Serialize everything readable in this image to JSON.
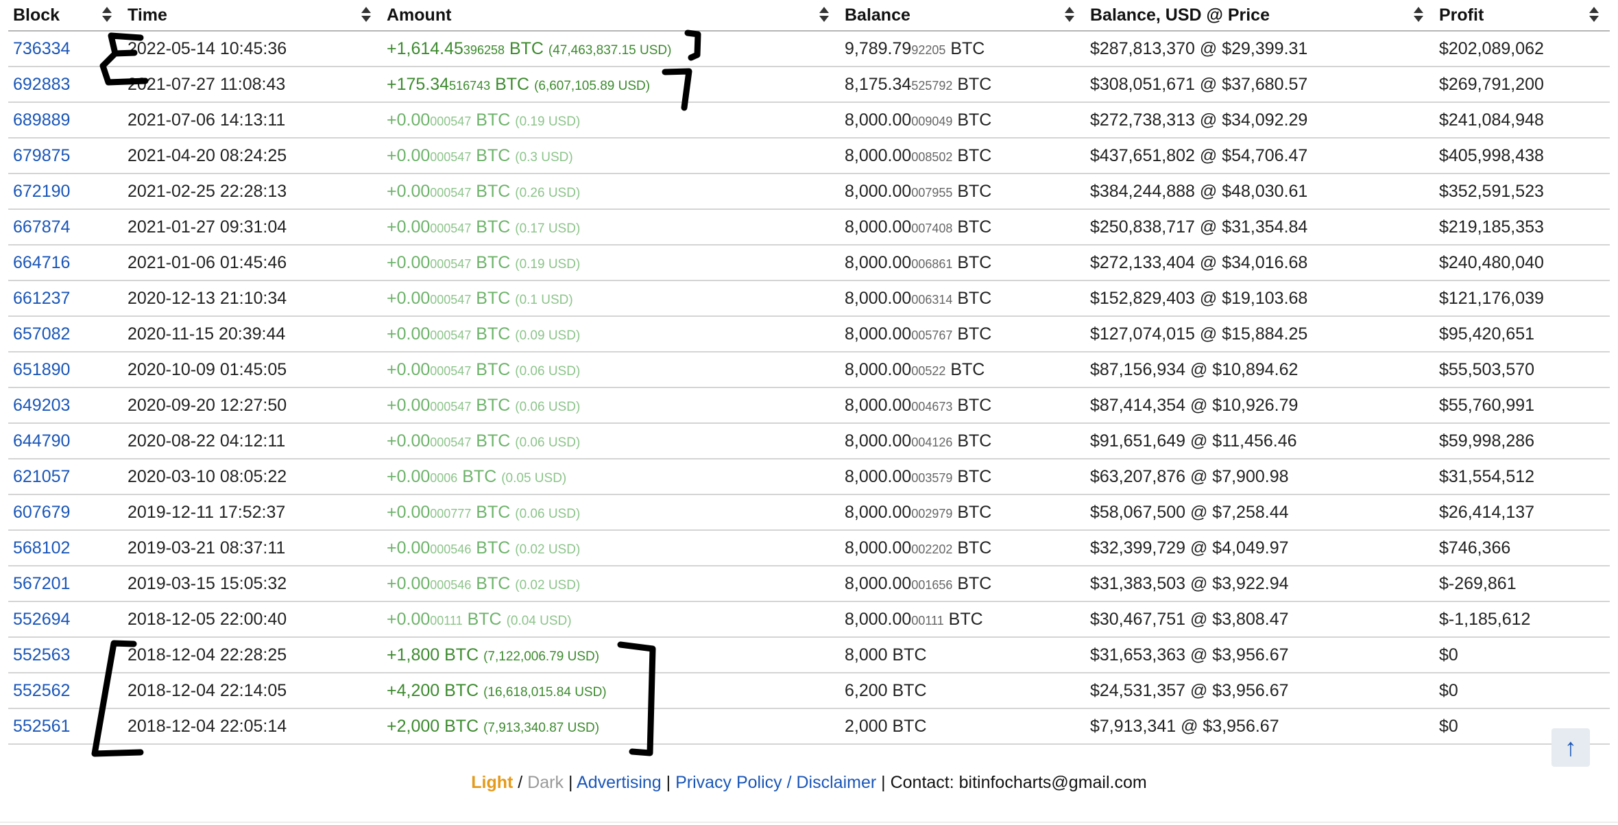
{
  "table": {
    "columns": [
      "Block",
      "Time",
      "Amount",
      "Balance",
      "Balance, USD @ Price",
      "Profit"
    ],
    "rows": [
      {
        "block": "736334",
        "time": "2022-05-14 10:45:36",
        "amt_main": "+1,614.45",
        "amt_frac": "396258",
        "amt_unit": " BTC ",
        "amt_usd": "(47,463,837.15 USD)",
        "amt_style": "big",
        "bal_main": "9,789.79",
        "bal_frac": "92205",
        "bal_unit": " BTC",
        "usd": "$287,813,370 @ $29,399.31",
        "profit": "$202,089,062"
      },
      {
        "block": "692883",
        "time": "2021-07-27 11:08:43",
        "amt_main": "+175.34",
        "amt_frac": "516743",
        "amt_unit": " BTC ",
        "amt_usd": "(6,607,105.89 USD)",
        "amt_style": "big",
        "bal_main": "8,175.34",
        "bal_frac": "525792",
        "bal_unit": " BTC",
        "usd": "$308,051,671 @ $37,680.57",
        "profit": "$269,791,200"
      },
      {
        "block": "689889",
        "time": "2021-07-06 14:13:11",
        "amt_main": "+0.00",
        "amt_frac": "000547",
        "amt_unit": " BTC ",
        "amt_usd": "(0.19 USD)",
        "amt_style": "small",
        "bal_main": "8,000.00",
        "bal_frac": "009049",
        "bal_unit": " BTC",
        "usd": "$272,738,313 @ $34,092.29",
        "profit": "$241,084,948"
      },
      {
        "block": "679875",
        "time": "2021-04-20 08:24:25",
        "amt_main": "+0.00",
        "amt_frac": "000547",
        "amt_unit": " BTC ",
        "amt_usd": "(0.3 USD)",
        "amt_style": "small",
        "bal_main": "8,000.00",
        "bal_frac": "008502",
        "bal_unit": " BTC",
        "usd": "$437,651,802 @ $54,706.47",
        "profit": "$405,998,438"
      },
      {
        "block": "672190",
        "time": "2021-02-25 22:28:13",
        "amt_main": "+0.00",
        "amt_frac": "000547",
        "amt_unit": " BTC ",
        "amt_usd": "(0.26 USD)",
        "amt_style": "small",
        "bal_main": "8,000.00",
        "bal_frac": "007955",
        "bal_unit": " BTC",
        "usd": "$384,244,888 @ $48,030.61",
        "profit": "$352,591,523"
      },
      {
        "block": "667874",
        "time": "2021-01-27 09:31:04",
        "amt_main": "+0.00",
        "amt_frac": "000547",
        "amt_unit": " BTC ",
        "amt_usd": "(0.17 USD)",
        "amt_style": "small",
        "bal_main": "8,000.00",
        "bal_frac": "007408",
        "bal_unit": " BTC",
        "usd": "$250,838,717 @ $31,354.84",
        "profit": "$219,185,353"
      },
      {
        "block": "664716",
        "time": "2021-01-06 01:45:46",
        "amt_main": "+0.00",
        "amt_frac": "000547",
        "amt_unit": " BTC ",
        "amt_usd": "(0.19 USD)",
        "amt_style": "small",
        "bal_main": "8,000.00",
        "bal_frac": "006861",
        "bal_unit": " BTC",
        "usd": "$272,133,404 @ $34,016.68",
        "profit": "$240,480,040"
      },
      {
        "block": "661237",
        "time": "2020-12-13 21:10:34",
        "amt_main": "+0.00",
        "amt_frac": "000547",
        "amt_unit": " BTC ",
        "amt_usd": "(0.1 USD)",
        "amt_style": "small",
        "bal_main": "8,000.00",
        "bal_frac": "006314",
        "bal_unit": " BTC",
        "usd": "$152,829,403 @ $19,103.68",
        "profit": "$121,176,039"
      },
      {
        "block": "657082",
        "time": "2020-11-15 20:39:44",
        "amt_main": "+0.00",
        "amt_frac": "000547",
        "amt_unit": " BTC ",
        "amt_usd": "(0.09 USD)",
        "amt_style": "small",
        "bal_main": "8,000.00",
        "bal_frac": "005767",
        "bal_unit": " BTC",
        "usd": "$127,074,015 @ $15,884.25",
        "profit": "$95,420,651"
      },
      {
        "block": "651890",
        "time": "2020-10-09 01:45:05",
        "amt_main": "+0.00",
        "amt_frac": "000547",
        "amt_unit": " BTC ",
        "amt_usd": "(0.06 USD)",
        "amt_style": "small",
        "bal_main": "8,000.00",
        "bal_frac": "00522",
        "bal_unit": " BTC",
        "usd": "$87,156,934 @ $10,894.62",
        "profit": "$55,503,570"
      },
      {
        "block": "649203",
        "time": "2020-09-20 12:27:50",
        "amt_main": "+0.00",
        "amt_frac": "000547",
        "amt_unit": " BTC ",
        "amt_usd": "(0.06 USD)",
        "amt_style": "small",
        "bal_main": "8,000.00",
        "bal_frac": "004673",
        "bal_unit": " BTC",
        "usd": "$87,414,354 @ $10,926.79",
        "profit": "$55,760,991"
      },
      {
        "block": "644790",
        "time": "2020-08-22 04:12:11",
        "amt_main": "+0.00",
        "amt_frac": "000547",
        "amt_unit": " BTC ",
        "amt_usd": "(0.06 USD)",
        "amt_style": "small",
        "bal_main": "8,000.00",
        "bal_frac": "004126",
        "bal_unit": " BTC",
        "usd": "$91,651,649 @ $11,456.46",
        "profit": "$59,998,286"
      },
      {
        "block": "621057",
        "time": "2020-03-10 08:05:22",
        "amt_main": "+0.00",
        "amt_frac": "0006",
        "amt_unit": " BTC ",
        "amt_usd": "(0.05 USD)",
        "amt_style": "small",
        "bal_main": "8,000.00",
        "bal_frac": "003579",
        "bal_unit": " BTC",
        "usd": "$63,207,876 @ $7,900.98",
        "profit": "$31,554,512"
      },
      {
        "block": "607679",
        "time": "2019-12-11 17:52:37",
        "amt_main": "+0.00",
        "amt_frac": "000777",
        "amt_unit": " BTC ",
        "amt_usd": "(0.06 USD)",
        "amt_style": "small",
        "bal_main": "8,000.00",
        "bal_frac": "002979",
        "bal_unit": " BTC",
        "usd": "$58,067,500 @ $7,258.44",
        "profit": "$26,414,137"
      },
      {
        "block": "568102",
        "time": "2019-03-21 08:37:11",
        "amt_main": "+0.00",
        "amt_frac": "000546",
        "amt_unit": " BTC ",
        "amt_usd": "(0.02 USD)",
        "amt_style": "small",
        "bal_main": "8,000.00",
        "bal_frac": "002202",
        "bal_unit": " BTC",
        "usd": "$32,399,729 @ $4,049.97",
        "profit": "$746,366"
      },
      {
        "block": "567201",
        "time": "2019-03-15 15:05:32",
        "amt_main": "+0.00",
        "amt_frac": "000546",
        "amt_unit": " BTC ",
        "amt_usd": "(0.02 USD)",
        "amt_style": "small",
        "bal_main": "8,000.00",
        "bal_frac": "001656",
        "bal_unit": " BTC",
        "usd": "$31,383,503 @ $3,922.94",
        "profit": "$-269,861"
      },
      {
        "block": "552694",
        "time": "2018-12-05 22:00:40",
        "amt_main": "+0.00",
        "amt_frac": "00111",
        "amt_unit": " BTC ",
        "amt_usd": "(0.04 USD)",
        "amt_style": "small",
        "bal_main": "8,000.00",
        "bal_frac": "00111",
        "bal_unit": " BTC",
        "usd": "$30,467,751 @ $3,808.47",
        "profit": "$-1,185,612"
      },
      {
        "block": "552563",
        "time": "2018-12-04 22:28:25",
        "amt_main": "+1,800",
        "amt_frac": "",
        "amt_unit": " BTC ",
        "amt_usd": "(7,122,006.79 USD)",
        "amt_style": "big",
        "bal_main": "8,000",
        "bal_frac": "",
        "bal_unit": " BTC",
        "usd": "$31,653,363 @ $3,956.67",
        "profit": "$0"
      },
      {
        "block": "552562",
        "time": "2018-12-04 22:14:05",
        "amt_main": "+4,200",
        "amt_frac": "",
        "amt_unit": " BTC ",
        "amt_usd": "(16,618,015.84 USD)",
        "amt_style": "big",
        "bal_main": "6,200",
        "bal_frac": "",
        "bal_unit": " BTC",
        "usd": "$24,531,357 @ $3,956.67",
        "profit": "$0"
      },
      {
        "block": "552561",
        "time": "2018-12-04 22:05:14",
        "amt_main": "+2,000",
        "amt_frac": "",
        "amt_unit": " BTC ",
        "amt_usd": "(7,913,340.87 USD)",
        "amt_style": "big",
        "bal_main": "2,000",
        "bal_frac": "",
        "bal_unit": " BTC",
        "usd": "$7,913,341 @ $3,956.67",
        "profit": "$0"
      }
    ]
  },
  "footer": {
    "light": "Light",
    "sep1": " / ",
    "dark": "Dark",
    "sep2": " | ",
    "advertising": "Advertising",
    "sep3": " | ",
    "privacy": "Privacy Policy / Disclaimer",
    "sep4": " | ",
    "contact": "Contact: bitinfocharts@gmail.com"
  },
  "scroll_top": {
    "icon": "arrow-up-icon",
    "glyph": "↑"
  },
  "colors": {
    "link": "#1a56b8",
    "amount_large": "#3c8a2e",
    "amount_small": "#6db36a",
    "theme_light": "#e49a1b",
    "annotation": "#000000"
  }
}
